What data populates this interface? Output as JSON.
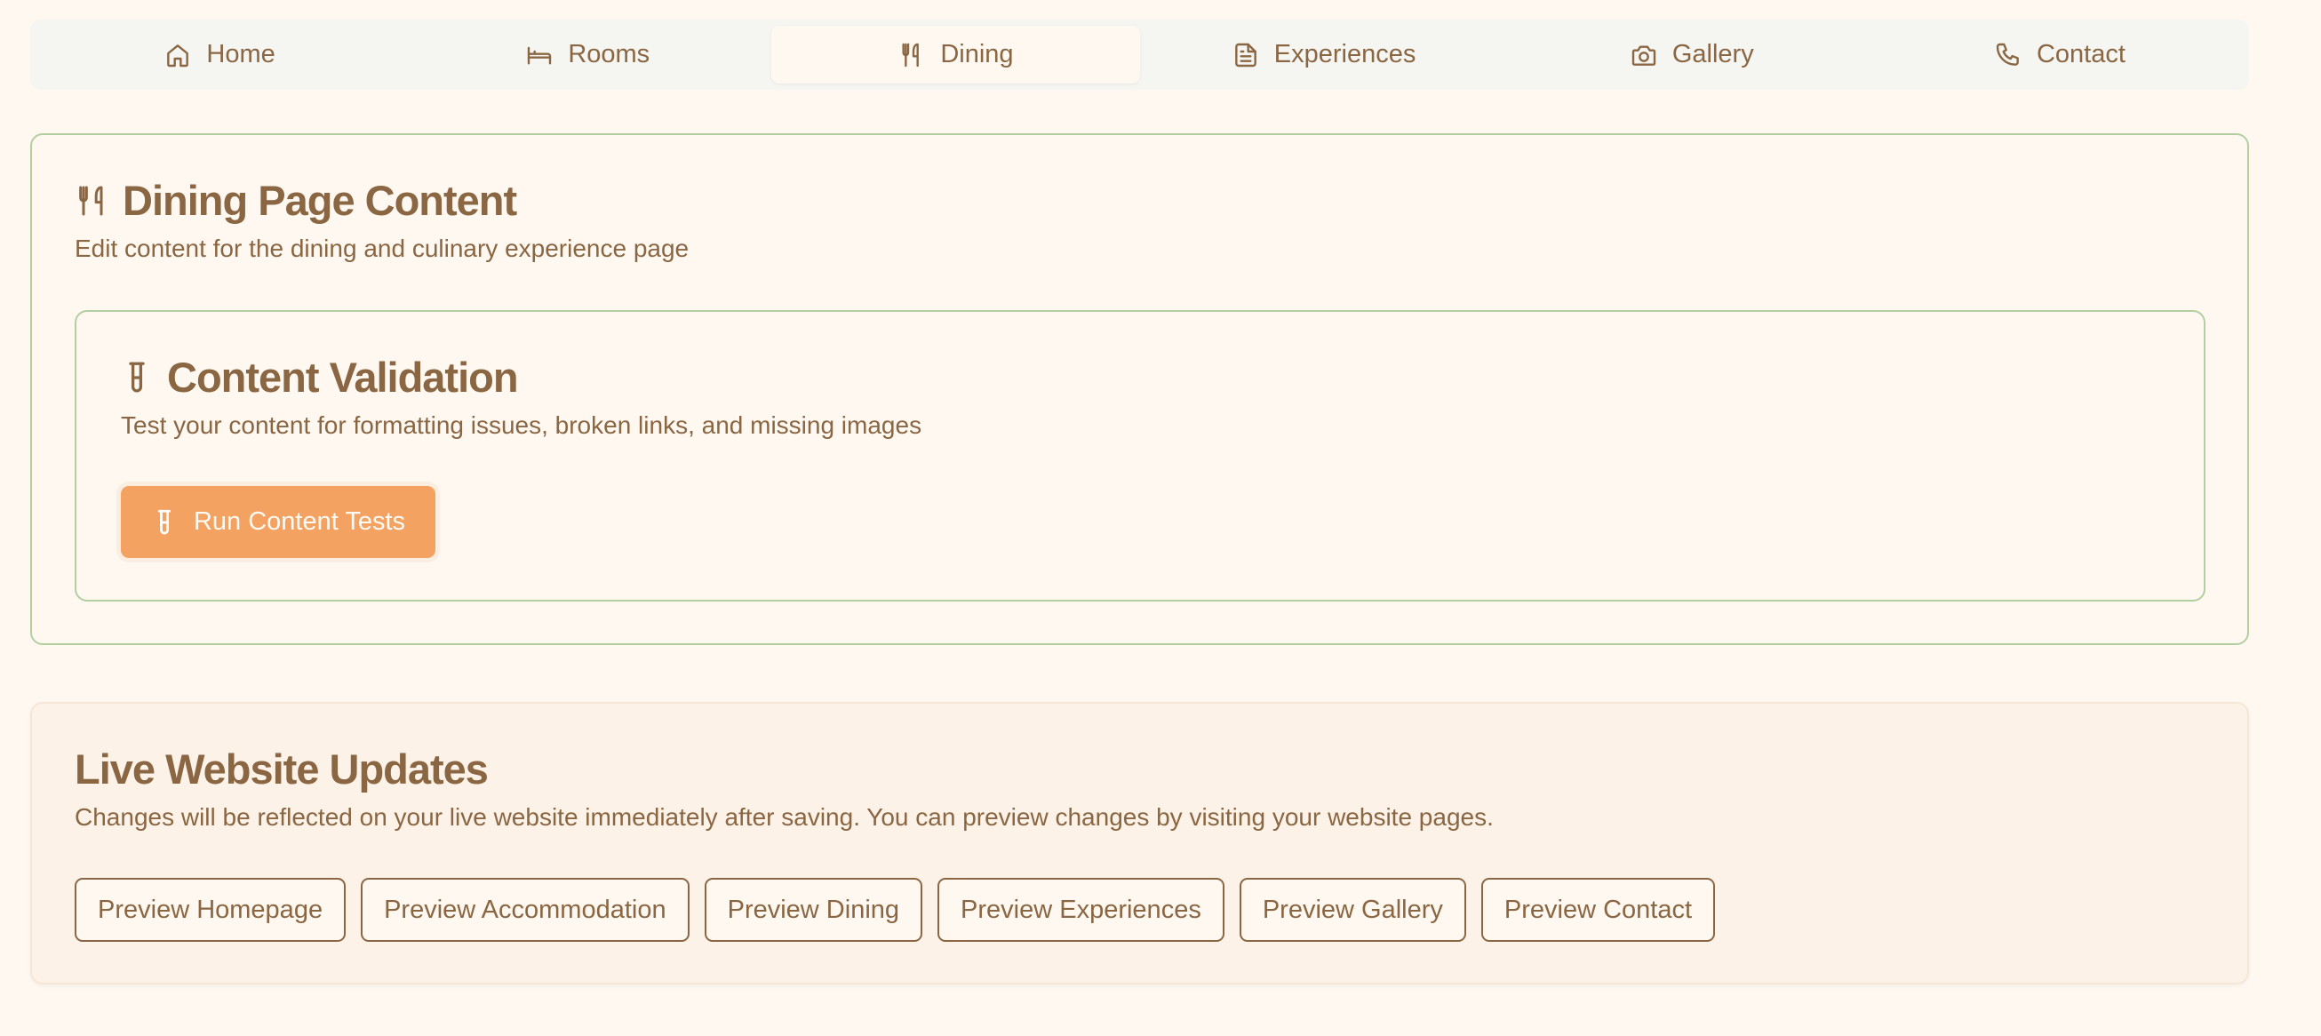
{
  "tabs": [
    {
      "label": "Home",
      "icon": "home-icon",
      "active": false
    },
    {
      "label": "Rooms",
      "icon": "bed-icon",
      "active": false
    },
    {
      "label": "Dining",
      "icon": "utensils-icon",
      "active": true
    },
    {
      "label": "Experiences",
      "icon": "file-text-icon",
      "active": false
    },
    {
      "label": "Gallery",
      "icon": "camera-icon",
      "active": false
    },
    {
      "label": "Contact",
      "icon": "phone-icon",
      "active": false
    }
  ],
  "dining": {
    "title": "Dining Page Content",
    "description": "Edit content for the dining and culinary experience page",
    "icon": "utensils-icon"
  },
  "validation": {
    "title": "Content Validation",
    "description": "Test your content for formatting issues, broken links, and missing images",
    "icon": "test-tube-icon",
    "run_button_label": "Run Content Tests"
  },
  "live_updates": {
    "title": "Live Website Updates",
    "description": "Changes will be reflected on your live website immediately after saving. You can preview changes by visiting your website pages.",
    "buttons": [
      {
        "label": "Preview Homepage"
      },
      {
        "label": "Preview Accommodation"
      },
      {
        "label": "Preview Dining"
      },
      {
        "label": "Preview Experiences"
      },
      {
        "label": "Preview Gallery"
      },
      {
        "label": "Preview Contact"
      }
    ]
  },
  "colors": {
    "text": "#8a6642",
    "accent": "#f4a261",
    "card_border": "#b3cfa2",
    "background": "#fef8f1"
  }
}
